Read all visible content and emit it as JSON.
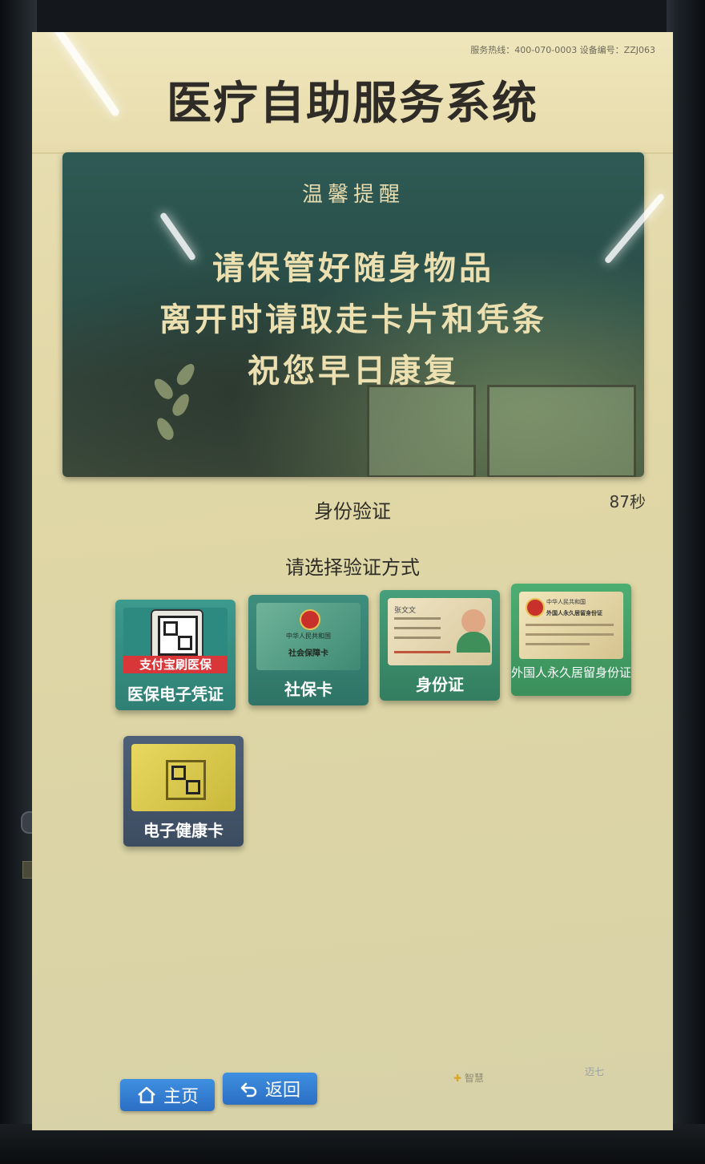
{
  "header": {
    "service_info": "服务热线：400-070-0003 设备编号：ZZJ063",
    "title": "医疗自助服务系统"
  },
  "notice": {
    "title": "温馨提醒",
    "lines": [
      "请保管好随身物品",
      "离开时请取走卡片和凭条",
      "祝您早日康复"
    ]
  },
  "verify": {
    "section_title": "身份验证",
    "countdown": "87秒",
    "prompt": "请选择验证方式",
    "options": [
      {
        "label": "医保电子凭证",
        "banner": "支付宝刷医保",
        "icon": "qr-code-phone-icon"
      },
      {
        "label": "社保卡",
        "card_head": "中华人民共和国",
        "card_name": "社会保障卡",
        "icon": "social-security-card-icon"
      },
      {
        "label": "身份证",
        "card_name": "张文文",
        "icon": "id-card-icon"
      },
      {
        "label": "外国人永久居留身份证",
        "card_head": "中华人民共和国",
        "card_name": "外国人永久居留身份证",
        "icon": "foreigner-id-card-icon"
      },
      {
        "label": "电子健康卡",
        "icon": "health-card-qr-icon"
      }
    ]
  },
  "footer": {
    "home_label": "主页",
    "back_label": "返回",
    "brand_left": "智慧",
    "brand_right": "迈七"
  },
  "colors": {
    "screen_bg": "#e4dbac",
    "notice_bg": "#2e5a55",
    "button_blue": "#2b6fc4"
  }
}
